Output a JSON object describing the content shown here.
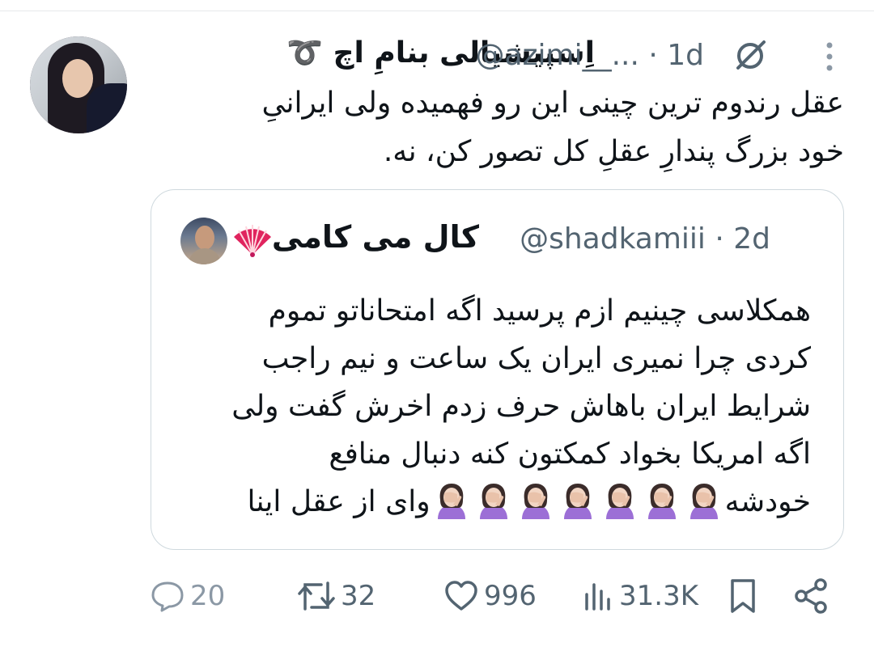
{
  "tweet": {
    "display_name": "اِسپیشیالی بنامِ اچ‌ ➰",
    "handle_time": "@azimi__... · 1d",
    "text_lines": [
      "عقل رندوم ترین چینی این رو فهمیده ولی ایرانیِ",
      "خود بزرگ پندارِ عقلِ کل تصور کن، نه."
    ]
  },
  "quote": {
    "display_name": "کال می کامی",
    "handle_time": "@shadkamiii · 2d",
    "text_lines": [
      "همکلاسی چینیم ازم پرسید اگه امتحاناتو تموم",
      "کردی چرا نمیری ایران یک ساعت و نیم راجب",
      "شرایط ایران باهاش حرف زدم اخرش گفت ولی",
      "اگه امریکا بخواد کمکتون کنه دنبال منافع"
    ],
    "last_line_start": "خودشه",
    "last_line_end": "وای از عقل اینا",
    "emoji_count": 7
  },
  "actions": {
    "replies": "20",
    "reposts": "32",
    "likes": "996",
    "views": "31.3K"
  },
  "icons": {
    "reply": "reply-bubble-icon",
    "repost": "repost-icon",
    "like": "heart-icon",
    "views": "bar-chart-icon",
    "bookmark": "bookmark-icon",
    "share": "share-icon",
    "grok": "grok-slash-icon",
    "more": "more-vertical-icon",
    "emoji": "woman-facepalming-emoji",
    "fan": "folding-fan-emoji"
  },
  "colors": {
    "text": "#0f1419",
    "secondary": "#536471",
    "border": "#cfd9de"
  }
}
